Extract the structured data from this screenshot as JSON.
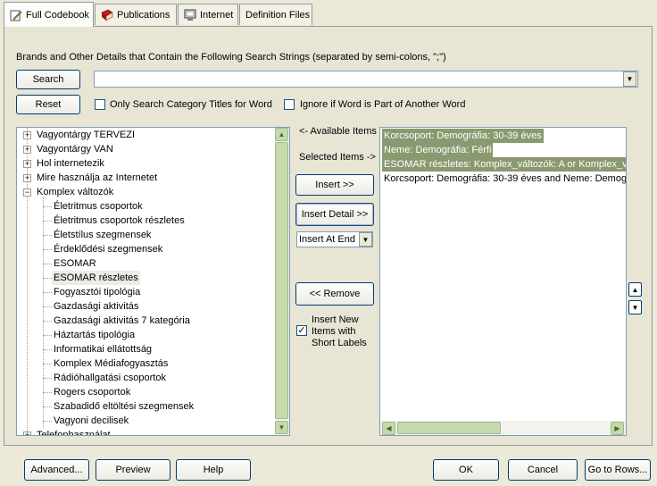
{
  "tabs": [
    {
      "label": "Full Codebook",
      "icon": "pencil-icon",
      "active": true
    },
    {
      "label": "Publications",
      "icon": "book-icon",
      "active": false
    },
    {
      "label": "Internet",
      "icon": "computer-icon",
      "active": false
    },
    {
      "label": "Definition Files",
      "icon": "",
      "active": false
    }
  ],
  "search": {
    "description": "Brands and Other Details that Contain the Following Search Strings (separated by semi-colons, \";\")",
    "search_label": "Search",
    "reset_label": "Reset",
    "value": "",
    "only_category_label": "Only Search Category Titles for Word",
    "only_category_checked": false,
    "ignore_part_label": "Ignore if Word is Part of Another Word",
    "ignore_part_checked": false
  },
  "tree": {
    "top_items": [
      {
        "label": "Vagyontárgy TERVEZI",
        "expanded": false
      },
      {
        "label": "Vagyontárgy VAN",
        "expanded": false
      },
      {
        "label": "Hol internetezik",
        "expanded": false
      },
      {
        "label": "Mire használja az Internetet",
        "expanded": false
      },
      {
        "label": "Komplex változók",
        "expanded": true
      }
    ],
    "children": [
      "Életritmus csoportok",
      "Életritmus csoportok részletes",
      "Életstílus szegmensek",
      "Érdeklődési szegmensek",
      "ESOMAR",
      "ESOMAR részletes",
      "Fogyasztói tipológia",
      "Gazdasági aktivitás",
      "Gazdasági aktivitás 7 kategória",
      "Háztartás tipológia",
      "Informatikai ellátottság",
      "Komplex Médiafogyasztás",
      "Rádióhallgatási csoportok",
      "Rogers csoportok",
      "Szabadidő eltöltési szegmensek",
      "Vagyoni decilisek"
    ],
    "selected_child": "ESOMAR részletes",
    "last_item": "Telefonhasználat"
  },
  "middle": {
    "available_label": "<- Available Items",
    "selected_label": "Selected Items ->",
    "insert_label": "Insert >>",
    "insert_detail_label": "Insert Detail >>",
    "insert_mode_value": "Insert At End",
    "remove_label": "<< Remove",
    "short_labels_text": "Insert New Items with Short Labels",
    "short_labels_checked": true
  },
  "selected_items": [
    {
      "label": "Korcsoport: Demográfia: 30-39 éves",
      "highlighted": true
    },
    {
      "label": "Neme: Demográfia: Férfi",
      "highlighted": true
    },
    {
      "label": "ESOMAR részletes: Komplex_változók: A or Komplex_vál",
      "highlighted": true
    },
    {
      "label": "Korcsoport: Demográfia: 30-39 éves and Neme: Demográ",
      "highlighted": false
    }
  ],
  "bottom": {
    "advanced_label": "Advanced...",
    "preview_label": "Preview",
    "help_label": "Help",
    "ok_label": "OK",
    "cancel_label": "Cancel",
    "goto_label": "Go to Rows..."
  },
  "colors": {
    "window_bg": "#ece9d8",
    "highlight_bg": "#8a9a70",
    "scrollbar_green": "#c4d9ac"
  }
}
